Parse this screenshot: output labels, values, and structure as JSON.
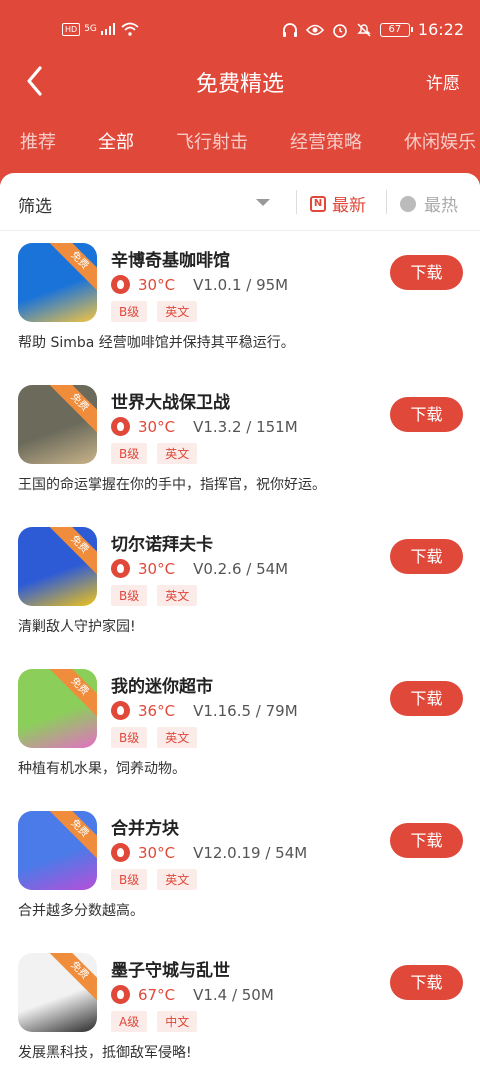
{
  "status": {
    "time": "16:22",
    "battery": "67",
    "hd": "HD",
    "net": "5G"
  },
  "header": {
    "title": "免费精选",
    "wish_label": "许愿"
  },
  "tabs": [
    "推荐",
    "全部",
    "飞行射击",
    "经营策略",
    "休闲娱乐"
  ],
  "active_tab": "全部",
  "filter": {
    "label": "筛选",
    "sort_new": "最新",
    "sort_hot": "最热"
  },
  "badge_text": "免费",
  "download_label": "下载",
  "apps": [
    {
      "name": "辛博奇基咖啡馆",
      "temp": "30°C",
      "version": "V1.0.1 / 95M",
      "grade": "B级",
      "lang": "英文",
      "desc": "帮助 Simba 经营咖啡馆并保持其平稳运行。",
      "icon": "cafe-cat-icon",
      "icon_colors": [
        "#1a73d9",
        "#f4c542"
      ]
    },
    {
      "name": "世界大战保卫战",
      "temp": "30°C",
      "version": "V1.3.2 / 151M",
      "grade": "B级",
      "lang": "英文",
      "desc": "王国的命运掌握在你的手中，指挥官，祝你好运。",
      "icon": "soldier-icon",
      "icon_colors": [
        "#6b6a5b",
        "#c9b48a"
      ]
    },
    {
      "name": "切尔诺拜夫卡",
      "temp": "30°C",
      "version": "V0.2.6 / 54M",
      "grade": "B级",
      "lang": "英文",
      "desc": "清剿敌人守护家园!",
      "icon": "bomb-icon",
      "icon_colors": [
        "#2d5bd6",
        "#f0c419"
      ]
    },
    {
      "name": "我的迷你超市",
      "temp": "36°C",
      "version": "V1.16.5 / 79M",
      "grade": "B级",
      "lang": "英文",
      "desc": "种植有机水果，饲养动物。",
      "icon": "supermarket-icon",
      "icon_colors": [
        "#8bcf5a",
        "#e46fc5"
      ]
    },
    {
      "name": "合并方块",
      "temp": "30°C",
      "version": "V12.0.19 / 54M",
      "grade": "B级",
      "lang": "英文",
      "desc": "合并越多分数越高。",
      "icon": "merge-blocks-icon",
      "icon_colors": [
        "#4a7be8",
        "#b74fd8"
      ]
    },
    {
      "name": "墨子守城与乱世",
      "temp": "67°C",
      "version": "V1.4 / 50M",
      "grade": "A级",
      "lang": "中文",
      "desc": "发展黑科技，抵御敌军侵略!",
      "icon": "ink-castle-icon",
      "icon_colors": [
        "#f2f2f2",
        "#2a2a2a"
      ]
    }
  ]
}
